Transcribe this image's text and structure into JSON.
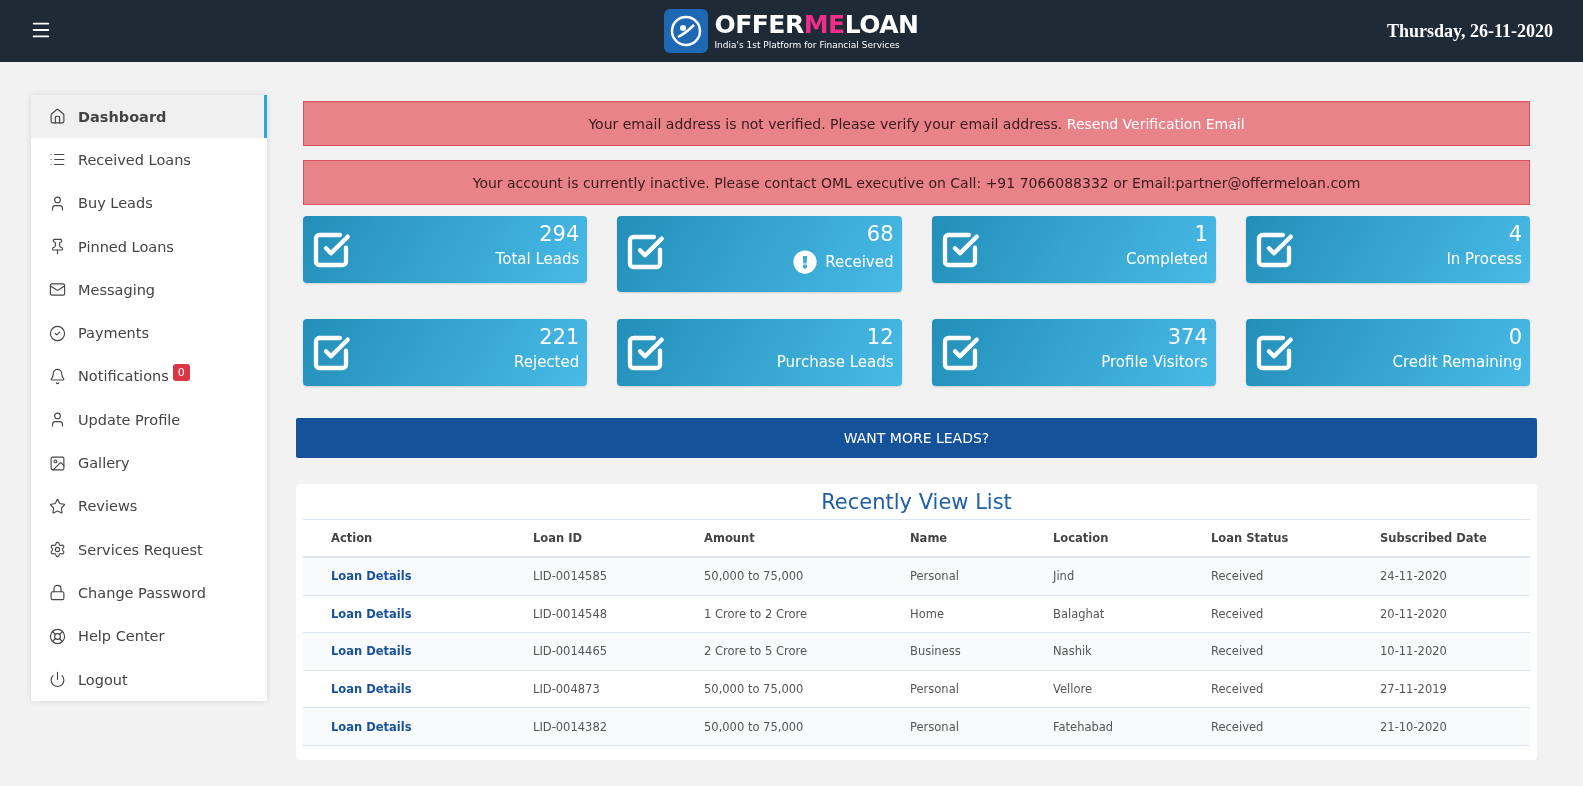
{
  "header": {
    "logo": {
      "words": [
        {
          "text": "OFFER",
          "accent": false
        },
        {
          "text": "ME",
          "accent": true
        },
        {
          "text": "LOAN",
          "accent": false
        }
      ],
      "tagline": "India's 1st Platform for Financial Services"
    },
    "date": "Thursday, 26-11-2020"
  },
  "sidebar": {
    "items": [
      {
        "label": "Dashboard",
        "selected": true
      },
      {
        "label": "Received Loans",
        "selected": false
      },
      {
        "label": "Buy Leads",
        "selected": false
      },
      {
        "label": "Pinned Loans",
        "selected": false
      },
      {
        "label": "Messaging",
        "selected": false
      },
      {
        "label": "Payments",
        "selected": false
      },
      {
        "label": "Notifications",
        "selected": false,
        "badge": "0"
      },
      {
        "label": "Update Profile",
        "selected": false
      },
      {
        "label": "Gallery",
        "selected": false
      },
      {
        "label": "Reviews",
        "selected": false
      },
      {
        "label": "Services Request",
        "selected": false
      },
      {
        "label": "Change Password",
        "selected": false
      },
      {
        "label": "Help Center",
        "selected": false
      },
      {
        "label": "Logout",
        "selected": false
      }
    ]
  },
  "alerts": [
    {
      "text": "Your email address is not verified. Please verify your email address.",
      "link": "Resend Verification Email"
    },
    {
      "text": "Your account is currently inactive. Please contact OML executive on Call: +91 7066088332 or Email:partner@offermeloan.com"
    }
  ],
  "stats": [
    {
      "value": "294",
      "label": "Total Leads",
      "alert": false
    },
    {
      "value": "68",
      "label": "Received",
      "alert": true
    },
    {
      "value": "1",
      "label": "Completed",
      "alert": false
    },
    {
      "value": "4",
      "label": "In Process",
      "alert": false
    },
    {
      "value": "221",
      "label": "Rejected",
      "alert": false
    },
    {
      "value": "12",
      "label": "Purchase Leads",
      "alert": false
    },
    {
      "value": "374",
      "label": "Profile Visitors",
      "alert": false
    },
    {
      "value": "0",
      "label": "Credit Remaining",
      "alert": false
    }
  ],
  "cta": "WANT MORE LEADS?",
  "table": {
    "title": "Recently View List",
    "columns": [
      "Action",
      "Loan ID",
      "Amount",
      "Name",
      "Location",
      "Loan Status",
      "Subscribed Date"
    ],
    "rows": [
      [
        "Loan Details",
        "LID-0014585",
        "50,000 to 75,000",
        "Personal",
        "Jind",
        "Received",
        "24-11-2020"
      ],
      [
        "Loan Details",
        "LID-0014548",
        "1 Crore to 2 Crore",
        "Home",
        "Balaghat",
        "Received",
        "20-11-2020"
      ],
      [
        "Loan Details",
        "LID-0014465",
        "2 Crore to 5 Crore",
        "Business",
        "Nashik",
        "Received",
        "10-11-2020"
      ],
      [
        "Loan Details",
        "LID-004873",
        "50,000 to 75,000",
        "Personal",
        "Vellore",
        "Received",
        "27-11-2019"
      ],
      [
        "Loan Details",
        "LID-0014382",
        "50,000 to 75,000",
        "Personal",
        "Fatehabad",
        "Received",
        "21-10-2020"
      ]
    ]
  }
}
